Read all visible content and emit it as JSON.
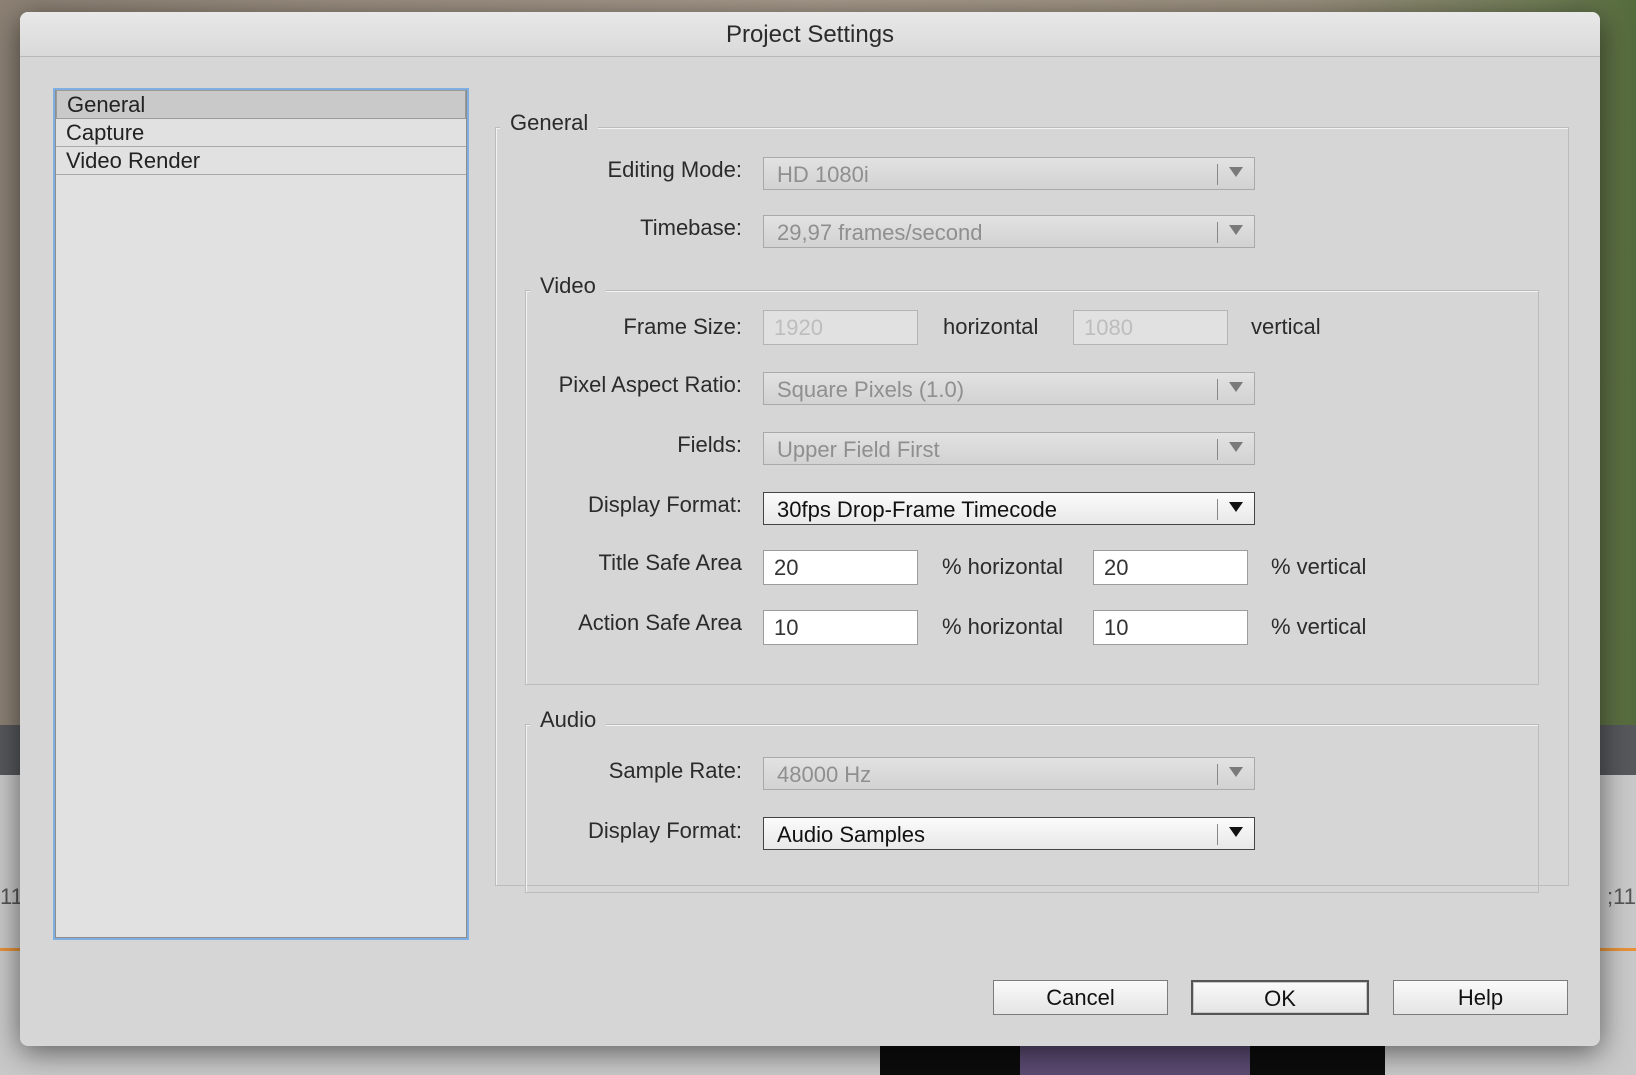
{
  "background": {
    "timecode_left": "11",
    "timecode_right": ";11"
  },
  "dialog": {
    "title": "Project Settings"
  },
  "sidebar": {
    "items": [
      {
        "label": "General",
        "selected": true
      },
      {
        "label": "Capture",
        "selected": false
      },
      {
        "label": "Video Render",
        "selected": false
      }
    ]
  },
  "general": {
    "group_label": "General",
    "editing_mode": {
      "label": "Editing Mode:",
      "value": "HD 1080i"
    },
    "timebase": {
      "label": "Timebase:",
      "value": "29,97 frames/second"
    }
  },
  "video": {
    "group_label": "Video",
    "frame_size": {
      "label": "Frame Size:",
      "horizontal": "1920",
      "horizontal_suffix": "horizontal",
      "vertical": "1080",
      "vertical_suffix": "vertical"
    },
    "pixel_aspect_ratio": {
      "label": "Pixel Aspect Ratio:",
      "value": "Square Pixels (1.0)"
    },
    "fields": {
      "label": "Fields:",
      "value": "Upper Field First"
    },
    "display_format": {
      "label": "Display Format:",
      "value": "30fps Drop-Frame Timecode"
    },
    "title_safe": {
      "label": "Title Safe Area",
      "horizontal": "20",
      "horizontal_suffix": "% horizontal",
      "vertical": "20",
      "vertical_suffix": "% vertical"
    },
    "action_safe": {
      "label": "Action Safe Area",
      "horizontal": "10",
      "horizontal_suffix": "% horizontal",
      "vertical": "10",
      "vertical_suffix": "% vertical"
    }
  },
  "audio": {
    "group_label": "Audio",
    "sample_rate": {
      "label": "Sample Rate:",
      "value": "48000 Hz"
    },
    "display_format": {
      "label": "Display Format:",
      "value": "Audio Samples"
    }
  },
  "buttons": {
    "cancel": "Cancel",
    "ok": "OK",
    "help": "Help"
  },
  "colors": {
    "dialog_bg": "#d6d6d6",
    "focus_ring": "#7faee0",
    "timeline_playhead": "#e7923a"
  }
}
